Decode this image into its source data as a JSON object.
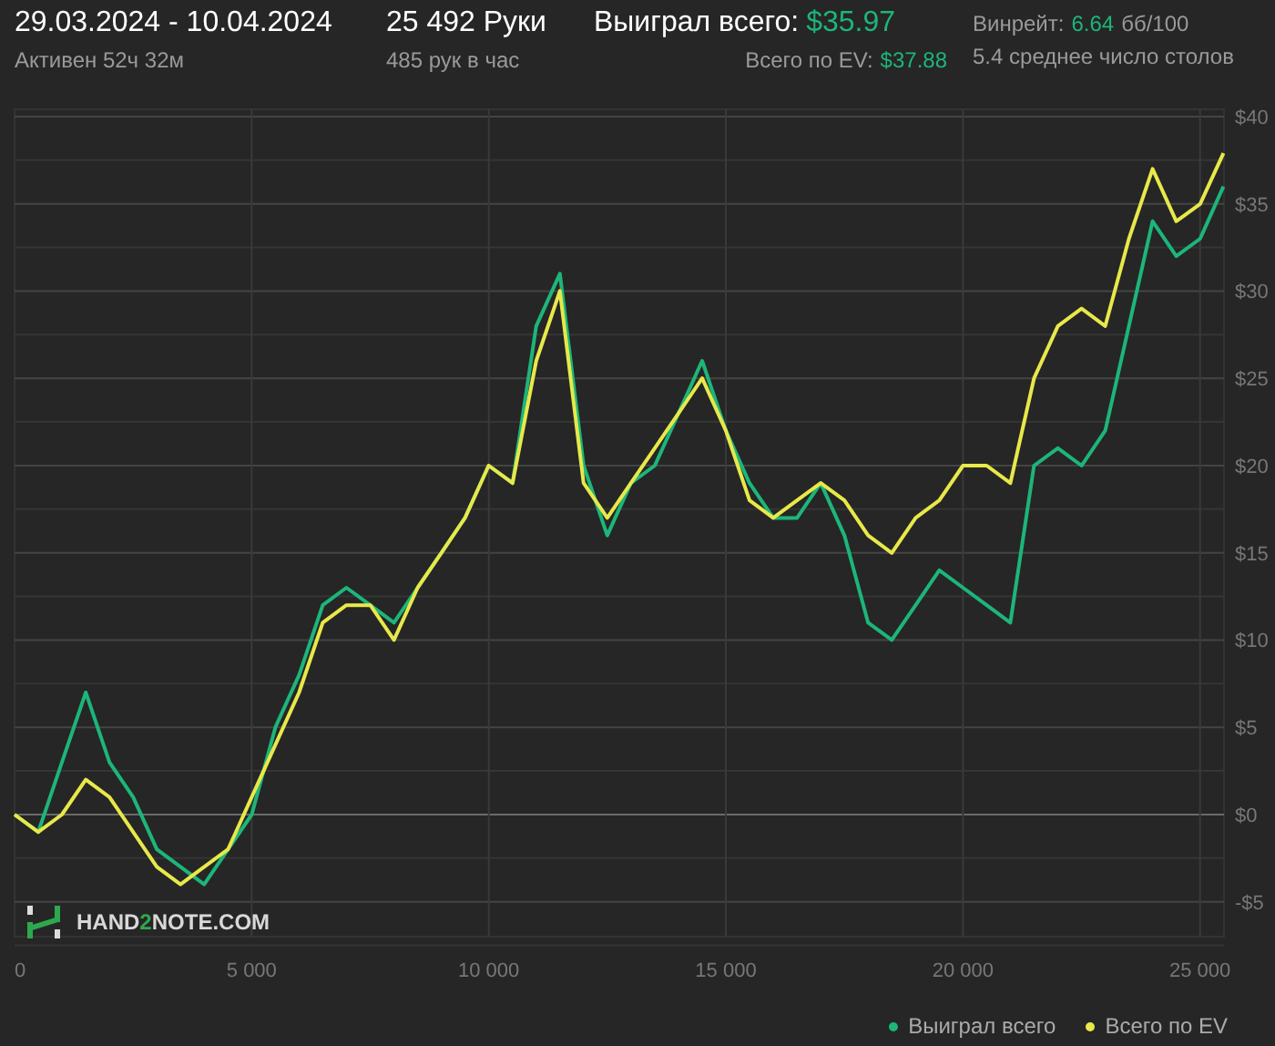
{
  "header": {
    "period": "29.03.2024 - 10.04.2024",
    "active": "Активен 52ч 32м",
    "hands": "25 492 Руки",
    "hands_per_hour": "485 рук в час",
    "won_label": "Выиграл всего:",
    "won_value": "$35.97",
    "ev_label": "Всего по EV:",
    "ev_value": "$37.88",
    "winrate_label": "Винрейт:",
    "winrate_value": "6.64",
    "winrate_unit": "бб/100",
    "tables": "5.4 среднее число столов"
  },
  "logo": {
    "text_parts": [
      "HAND",
      "2",
      "NOTE.COM"
    ]
  },
  "chart": {
    "chart_data": {
      "type": "line",
      "x": [
        0,
        500,
        1000,
        1500,
        2000,
        2500,
        3000,
        3500,
        4000,
        4500,
        5000,
        5500,
        6000,
        6500,
        7000,
        7500,
        8000,
        8500,
        9000,
        9500,
        10000,
        10500,
        11000,
        11500,
        12000,
        12500,
        13000,
        13500,
        14000,
        14500,
        15000,
        15500,
        16000,
        16500,
        17000,
        17500,
        18000,
        18500,
        19000,
        19500,
        20000,
        20500,
        21000,
        21500,
        22000,
        22500,
        23000,
        23500,
        24000,
        24500,
        25000,
        25492
      ],
      "series": [
        {
          "name": "Выиграл всего",
          "color": "#1db57a",
          "values": [
            0,
            -1,
            3,
            7,
            3,
            1,
            -2,
            -3,
            -4,
            -2,
            0,
            5,
            8,
            12,
            13,
            12,
            11,
            13,
            15,
            17,
            20,
            19,
            28,
            31,
            20,
            16,
            19,
            20,
            23,
            26,
            22,
            19,
            17,
            17,
            19,
            16,
            11,
            10,
            12,
            14,
            13,
            12,
            11,
            20,
            21,
            20,
            22,
            28,
            34,
            32,
            33,
            36
          ]
        },
        {
          "name": "Всего по EV",
          "color": "#e8e84a",
          "values": [
            0,
            -1,
            0,
            2,
            1,
            -1,
            -3,
            -4,
            -3,
            -2,
            1,
            4,
            7,
            11,
            12,
            12,
            10,
            13,
            15,
            17,
            20,
            19,
            26,
            30,
            19,
            17,
            19,
            21,
            23,
            25,
            22,
            18,
            17,
            18,
            19,
            18,
            16,
            15,
            17,
            18,
            20,
            20,
            19,
            25,
            28,
            29,
            28,
            33,
            37,
            34,
            35,
            37.9
          ]
        }
      ],
      "grid": true,
      "xlim": [
        0,
        25492
      ],
      "ylim": [
        -7,
        40
      ],
      "xticks": [
        0,
        {
          "value": 5000,
          "label": "5 000"
        },
        {
          "value": 10000,
          "label": "10 000"
        },
        {
          "value": 15000,
          "label": "15 000"
        },
        {
          "value": 20000,
          "label": "20 000"
        },
        {
          "value": 25000,
          "label": "25 000"
        }
      ],
      "yticks": [
        {
          "value": -5,
          "label": "-$5"
        },
        {
          "value": 0,
          "label": "$0"
        },
        {
          "value": 5,
          "label": "$5"
        },
        {
          "value": 10,
          "label": "$10"
        },
        {
          "value": 15,
          "label": "$15"
        },
        {
          "value": 20,
          "label": "$20"
        },
        {
          "value": 25,
          "label": "$25"
        },
        {
          "value": 30,
          "label": "$30"
        },
        {
          "value": 35,
          "label": "$35"
        },
        {
          "value": 40,
          "label": "$40"
        }
      ]
    }
  }
}
